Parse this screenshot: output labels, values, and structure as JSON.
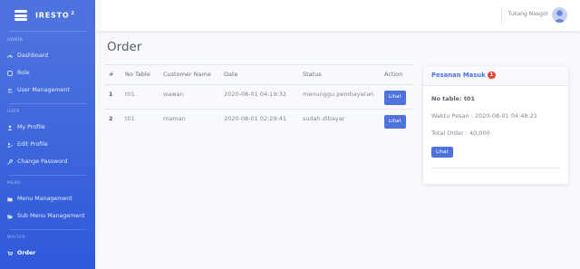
{
  "brand": {
    "name": "IRESTO",
    "sup": "2"
  },
  "sidebar": {
    "sections": [
      {
        "heading": "ADMIN",
        "items": [
          {
            "label": "Dashboard",
            "icon": "tachometer-icon"
          },
          {
            "label": "Role",
            "icon": "role-icon"
          },
          {
            "label": "User Management",
            "icon": "users-icon"
          }
        ]
      },
      {
        "heading": "USER",
        "items": [
          {
            "label": "My Profile",
            "icon": "user-icon"
          },
          {
            "label": "Edit Profile",
            "icon": "user-edit-icon"
          },
          {
            "label": "Change Password",
            "icon": "key-icon"
          }
        ]
      },
      {
        "heading": "MENU",
        "items": [
          {
            "label": "Menu Management",
            "icon": "folder-icon"
          },
          {
            "label": "Sub Menu Management",
            "icon": "folder-open-icon"
          }
        ]
      },
      {
        "heading": "WAITER",
        "items": [
          {
            "label": "Order",
            "icon": "cart-icon",
            "active": true
          }
        ]
      }
    ]
  },
  "topbar": {
    "user_name": "Tukang Nasgor"
  },
  "main": {
    "title": "Order",
    "table": {
      "headers": [
        "#",
        "No Table",
        "Customer Name",
        "Date",
        "Status",
        "Action"
      ],
      "rows": [
        {
          "num": "1",
          "table": "t01",
          "customer": "wawan",
          "date": "2020-08-01 04:19:32",
          "status": "menunggu pembayaran",
          "action": "Lihat"
        },
        {
          "num": "2",
          "table": "t01",
          "customer": "maman",
          "date": "2020-08-01 02:29:41",
          "status": "sudah dibayar",
          "action": "Lihat"
        }
      ]
    }
  },
  "card": {
    "title": "Pesanan Masuk",
    "badge": "1",
    "table_label": "No table: t01",
    "time": "Waktu Pesan : 2020-08-01 04:48:21",
    "total": "Total Order : 40,000",
    "button": "Lihat"
  },
  "colors": {
    "primary": "#4e73df",
    "danger": "#e74a3b",
    "background": "#f8f9fc"
  }
}
